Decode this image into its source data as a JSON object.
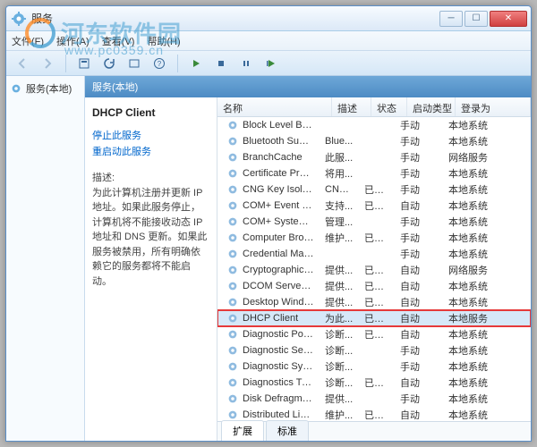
{
  "window": {
    "title": "服务"
  },
  "menu": {
    "file": "文件(F)",
    "action": "操作(A)",
    "view": "查看(V)",
    "help": "帮助(H)"
  },
  "tree": {
    "root": "服务(本地)"
  },
  "localHeader": "服务(本地)",
  "detail": {
    "title": "DHCP Client",
    "stopLink": "停止此服务",
    "restartLink": "重启动此服务",
    "descLabel": "描述:",
    "descText": "为此计算机注册并更新 IP 地址。如果此服务停止，计算机将不能接收动态 IP 地址和 DNS 更新。如果此服务被禁用，所有明确依赖它的服务都将不能启动。"
  },
  "columns": {
    "name": "名称",
    "desc": "描述",
    "status": "状态",
    "type": "启动类型",
    "logon": "登录为"
  },
  "tabs": {
    "extended": "扩展",
    "standard": "标准"
  },
  "watermark": {
    "main": "河东软件园",
    "sub": "www.pc0359.cn"
  },
  "services": [
    {
      "name": "Block Level Back...",
      "desc": "",
      "status": "",
      "type": "手动",
      "logon": "本地系统"
    },
    {
      "name": "Bluetooth Supp...",
      "desc": "Blue...",
      "status": "",
      "type": "手动",
      "logon": "本地系统"
    },
    {
      "name": "BranchCache",
      "desc": "此服...",
      "status": "",
      "type": "手动",
      "logon": "网络服务"
    },
    {
      "name": "Certificate Propa...",
      "desc": "将用...",
      "status": "",
      "type": "手动",
      "logon": "本地系统"
    },
    {
      "name": "CNG Key Isolation",
      "desc": "CNG...",
      "status": "已启动",
      "type": "手动",
      "logon": "本地系统"
    },
    {
      "name": "COM+ Event Sys...",
      "desc": "支持...",
      "status": "已启动",
      "type": "自动",
      "logon": "本地系统"
    },
    {
      "name": "COM+ System A...",
      "desc": "管理...",
      "status": "",
      "type": "手动",
      "logon": "本地系统"
    },
    {
      "name": "Computer Brow...",
      "desc": "维护...",
      "status": "已启动",
      "type": "手动",
      "logon": "本地系统"
    },
    {
      "name": "Credential Mana...",
      "desc": "",
      "status": "",
      "type": "手动",
      "logon": "本地系统"
    },
    {
      "name": "Cryptographic S...",
      "desc": "提供...",
      "status": "已启动",
      "type": "自动",
      "logon": "网络服务"
    },
    {
      "name": "DCOM Server Pr...",
      "desc": "提供...",
      "status": "已启动",
      "type": "自动",
      "logon": "本地系统"
    },
    {
      "name": "Desktop Windo...",
      "desc": "提供...",
      "status": "已启动",
      "type": "自动",
      "logon": "本地系统"
    },
    {
      "name": "DHCP Client",
      "desc": "为此...",
      "status": "已启动",
      "type": "自动",
      "logon": "本地服务",
      "hl": true
    },
    {
      "name": "Diagnostic Polic...",
      "desc": "诊断...",
      "status": "已启动",
      "type": "自动",
      "logon": "本地系统"
    },
    {
      "name": "Diagnostic Servi...",
      "desc": "诊断...",
      "status": "",
      "type": "手动",
      "logon": "本地系统"
    },
    {
      "name": "Diagnostic Syste...",
      "desc": "诊断...",
      "status": "",
      "type": "手动",
      "logon": "本地系统"
    },
    {
      "name": "Diagnostics Trac...",
      "desc": "诊断...",
      "status": "已启动",
      "type": "自动",
      "logon": "本地系统"
    },
    {
      "name": "Disk Defragmen...",
      "desc": "提供...",
      "status": "",
      "type": "手动",
      "logon": "本地系统"
    },
    {
      "name": "Distributed Link ...",
      "desc": "维护...",
      "status": "已启动",
      "type": "自动",
      "logon": "本地系统"
    }
  ]
}
